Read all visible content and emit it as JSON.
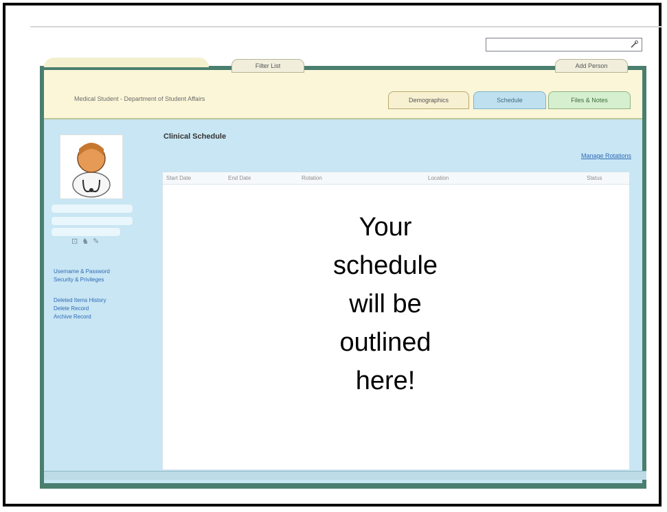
{
  "header": {
    "title": "Medical Student - Department of Student Affairs",
    "filter_tab": "Filter List",
    "add_person": "Add Person"
  },
  "tabs": [
    {
      "label": "Demographics"
    },
    {
      "label": "Schedule"
    },
    {
      "label": "Files & Notes"
    }
  ],
  "sidebar": {
    "links": [
      "Username & Password",
      "Security & Privileges",
      "Deleted Items History",
      "Delete Record",
      "Archive Record"
    ]
  },
  "main": {
    "section_title": "Clinical Schedule",
    "manage_link": "Manage Rotations",
    "columns": [
      "Start Date",
      "End Date",
      "Rotation",
      "Location",
      "Status"
    ],
    "message": "Your\nschedule\nwill be\noutlined\nhere!"
  },
  "colors": {
    "frame": "#4a7e6e",
    "panel": "#c8e6f3",
    "header": "#fbf6d8"
  }
}
